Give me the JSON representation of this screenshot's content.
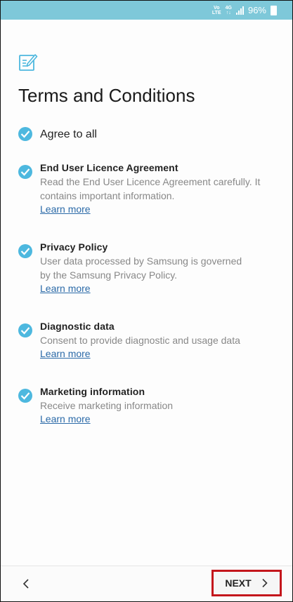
{
  "status_bar": {
    "volte_top": "Vo",
    "volte_bottom": "LTE",
    "network_top": "4G",
    "network_bottom": "↑↓",
    "battery_percent": "96%"
  },
  "header": {
    "icon": "edit-document-icon",
    "title": "Terms and Conditions"
  },
  "agree_all": {
    "label": "Agree to all",
    "checked": true
  },
  "items": [
    {
      "title": "End User Licence Agreement",
      "description": "Read the End User Licence Agreement carefully. It contains important information.",
      "link": "Learn more",
      "checked": true
    },
    {
      "title": "Privacy Policy",
      "description": "User data processed by Samsung is governed by the Samsung Privacy Policy.",
      "link": "Learn more",
      "checked": true
    },
    {
      "title": "Diagnostic data",
      "description": "Consent to provide diagnostic and usage data",
      "link": "Learn more",
      "checked": true
    },
    {
      "title": "Marketing information",
      "description": "Receive marketing information",
      "link": "Learn more",
      "checked": true
    }
  ],
  "bottom_bar": {
    "back_icon": "chevron-left-icon",
    "next_label": "NEXT",
    "next_icon": "chevron-right-icon"
  },
  "colors": {
    "status_bar": "#7ec8d9",
    "check": "#4db8df",
    "link": "#2b6aa8",
    "highlight": "#c4161c"
  }
}
